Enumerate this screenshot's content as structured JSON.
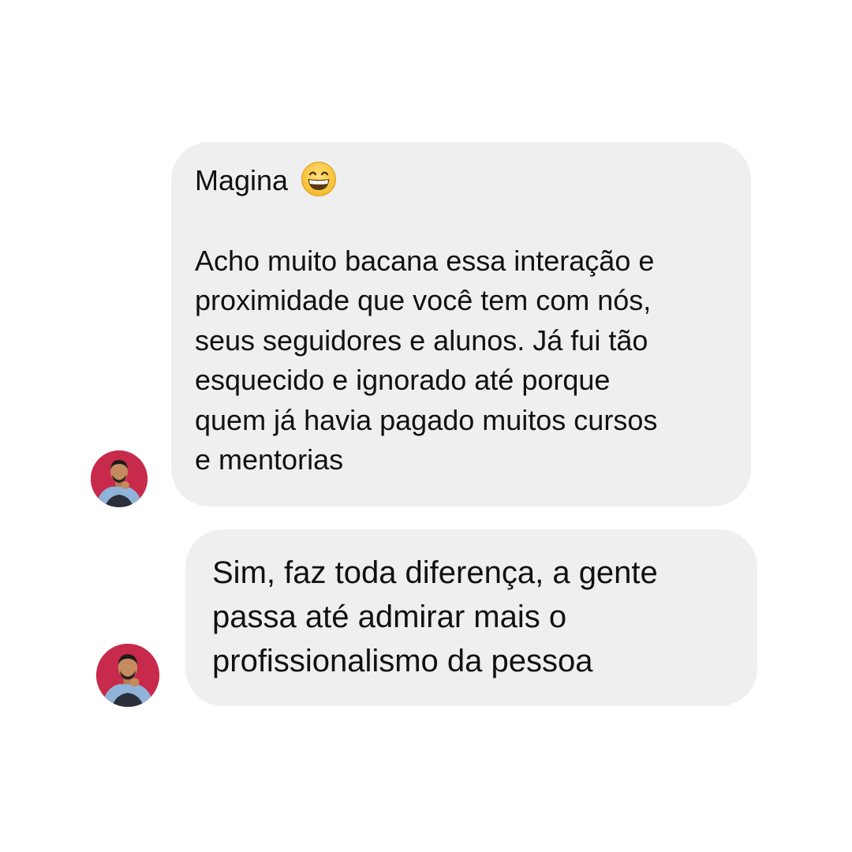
{
  "messages": [
    {
      "first_line": "Magina",
      "emoji": "grinning-face-emoji",
      "body": "Acho muito bacana essa interação e\nproximidade que você tem com nós,\nseus seguidores e alunos. Já fui tão\nesquecido e ignorado até porque\nquem já havia pagado muitos cursos\ne mentorias"
    },
    {
      "body": "Sim, faz toda diferença, a gente\npassa até admirar mais o\nprofissionalismo da pessoa"
    }
  ],
  "colors": {
    "bubble": "#efefef",
    "avatar_bg": "#c72a4a",
    "text": "#111111"
  }
}
